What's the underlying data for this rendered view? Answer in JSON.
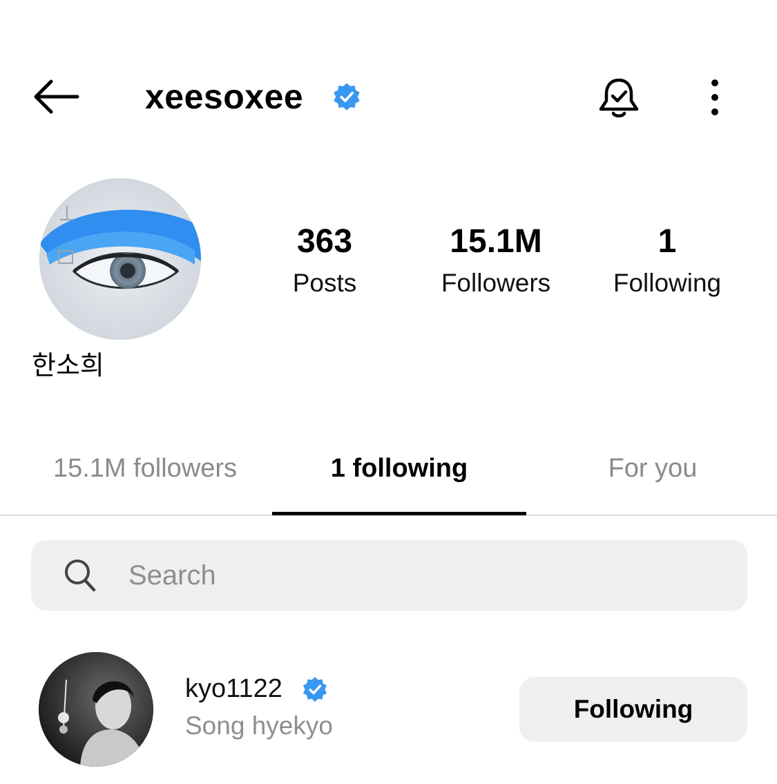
{
  "header": {
    "username": "xeesoxee",
    "verified_icon": "verified-badge-icon",
    "back_icon": "arrow-left-icon",
    "bell_icon": "bell-check-icon",
    "more_icon": "more-vertical-icon",
    "accent_color": "#3897f0"
  },
  "profile": {
    "display_name": "한소희",
    "stats": [
      {
        "value": "363",
        "label": "Posts"
      },
      {
        "value": "15.1M",
        "label": "Followers"
      },
      {
        "value": "1",
        "label": "Following"
      }
    ]
  },
  "tabs": [
    {
      "label": "15.1M followers",
      "active": false
    },
    {
      "label": "1 following",
      "active": true
    },
    {
      "label": "For you",
      "active": false
    }
  ],
  "search": {
    "placeholder": "Search",
    "value": ""
  },
  "following_list": [
    {
      "username": "kyo1122",
      "verified": true,
      "full_name": "Song hyekyo",
      "button_label": "Following"
    }
  ]
}
